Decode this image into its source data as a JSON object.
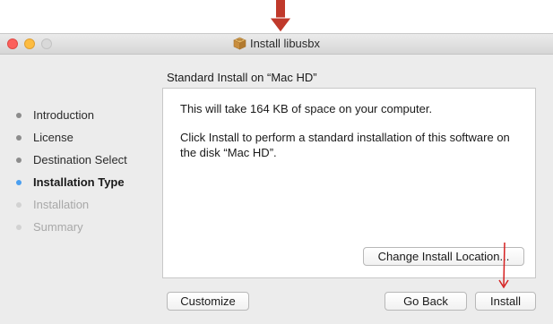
{
  "window": {
    "title": "Install libusbx",
    "app_icon": "package-icon"
  },
  "sidebar": {
    "steps": [
      {
        "label": "Introduction",
        "state": "done"
      },
      {
        "label": "License",
        "state": "done"
      },
      {
        "label": "Destination Select",
        "state": "done"
      },
      {
        "label": "Installation Type",
        "state": "current"
      },
      {
        "label": "Installation",
        "state": "future"
      },
      {
        "label": "Summary",
        "state": "future"
      }
    ]
  },
  "main": {
    "section_title": "Standard Install on “Mac HD”",
    "space_text": "This will take 164 KB of space on your computer.",
    "instruction_text": "Click Install to perform a standard installation of this software on the disk “Mac HD”.",
    "change_location_label": "Change Install Location..."
  },
  "footer": {
    "customize_label": "Customize",
    "back_label": "Go Back",
    "install_label": "Install"
  },
  "colors": {
    "annotation_arrow": "#c0392b",
    "current_step_dot": "#4a9ff0",
    "close_button": "#fc605c",
    "minimize_button": "#fdbc40"
  }
}
